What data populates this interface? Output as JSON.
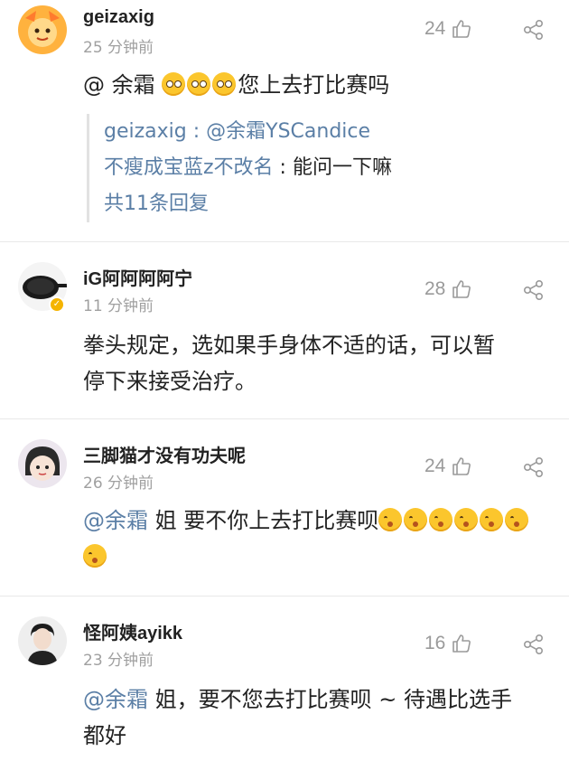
{
  "comments": [
    {
      "username": "geizaxig",
      "time": "25 分钟前",
      "likes": "24",
      "text_prefix": "@ 余霜 ",
      "emoji": [
        "flushed-emoji",
        "flushed-emoji",
        "flushed-emoji"
      ],
      "text_suffix": "您上去打比赛吗",
      "replies": [
        {
          "author": "geizaxig",
          "sep": " : ",
          "text": "@余霜YSCandice"
        },
        {
          "author": "不瘦成宝蓝z不改名",
          "sep": " : ",
          "text": "能问一下嘛"
        }
      ],
      "replies_more": "共11条回复"
    },
    {
      "username": "iG阿阿阿阿宁",
      "time": "11 分钟前",
      "likes": "28",
      "verified": true,
      "text": "拳头规定，选如果手身体不适的话，可以暂停下来接受治疗。"
    },
    {
      "username": "三脚猫才没有功夫呢",
      "time": "26 分钟前",
      "likes": "24",
      "mention": "@余霜",
      "text": " 姐 要不你上去打比赛呗",
      "emoji": [
        "kissing-emoji",
        "kissing-emoji",
        "kissing-emoji",
        "kissing-emoji",
        "kissing-emoji",
        "kissing-emoji",
        "kissing-emoji"
      ]
    },
    {
      "username": "怪阿姨ayikk",
      "time": "23 分钟前",
      "likes": "16",
      "mention": "@余霜",
      "text": " 姐，要不您去打比赛呗 ~ 待遇比选手都好"
    }
  ],
  "colors": {
    "mention": "#5b7fa6",
    "text": "#222222",
    "meta": "#a0a0a0",
    "like": "#9a9a9a",
    "badge": "#f5b400"
  }
}
